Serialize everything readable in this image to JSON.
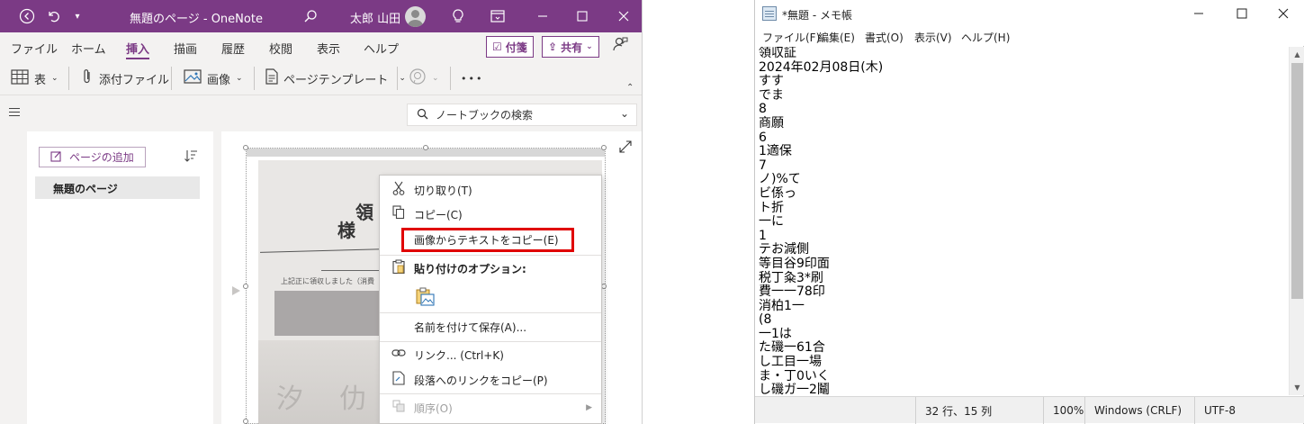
{
  "onenote": {
    "title": "無題のページ - OneNote",
    "user_name": "太郎 山田",
    "menu": [
      "ファイル",
      "ホーム",
      "挿入",
      "描画",
      "履歴",
      "校閲",
      "表示",
      "ヘルプ"
    ],
    "active_menu": "挿入",
    "sticky_label": "付箋",
    "share_label": "共有",
    "toolbar": {
      "table": "表",
      "attach": "添付ファイル",
      "image": "画像",
      "page_template": "ページテンプレート",
      "more": "•••"
    },
    "search_placeholder": "ノートブックの検索",
    "add_page": "ページの追加",
    "page_item": "無題のページ",
    "photo_text": {
      "char1": "領",
      "char2": "様",
      "small": "上記正に領収しました（消費"
    },
    "context_menu": {
      "cut": "切り取り(T)",
      "copy": "コピー(C)",
      "copy_text_from_image": "画像からテキストをコピー(E)",
      "paste_options": "貼り付けのオプション:",
      "save_as": "名前を付けて保存(A)...",
      "link": "リンク...  (Ctrl+K)",
      "copy_paragraph_link": "段落へのリンクをコピー(P)",
      "order": "順序(O)"
    }
  },
  "notepad": {
    "title": "*無題 - メモ帳",
    "menu": [
      "ファイル(F)",
      "編集(E)",
      "書式(O)",
      "表示(V)",
      "ヘルプ(H)"
    ],
    "lines": [
      "領収証",
      "2024年02月08日(木)",
      "すす",
      "でま",
      "8",
      "商願",
      "6",
      "1適保",
      "7",
      "ノ)%て",
      "ビ係っ",
      "ト折",
      "一に",
      "1",
      "テお減側",
      "等目谷9印面",
      "税丁粂3*刷",
      "費一一78印",
      "消柏1一",
      "(8",
      "一1は",
      "た磯一61合",
      "し工目一場",
      "ま・丁0いく",
      "し磯ガ一2鬮"
    ],
    "status": {
      "position": "32 行、15 列",
      "zoom": "100%",
      "line_ending": "Windows (CRLF)",
      "encoding": "UTF-8"
    }
  },
  "colors": {
    "onenote_accent": "#7b3a85",
    "highlight_box": "#e00000"
  }
}
